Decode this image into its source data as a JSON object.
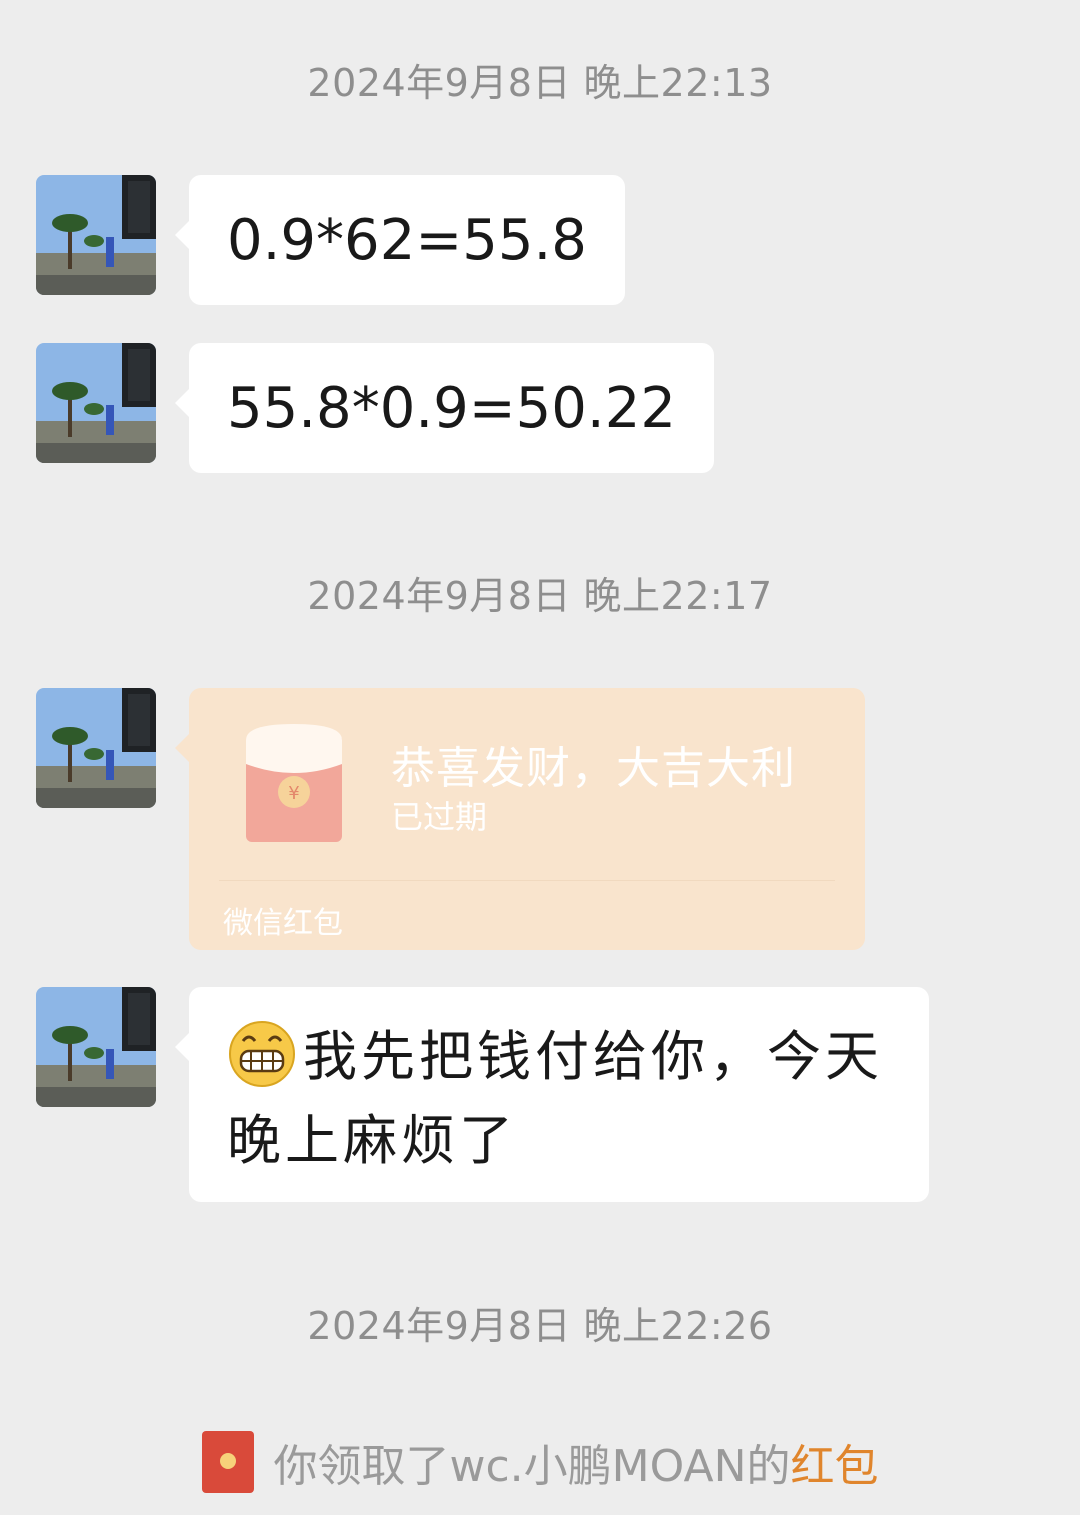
{
  "timestamps": [
    "2024年9月8日 晚上22:13",
    "2024年9月8日 晚上22:17",
    "2024年9月8日 晚上22:26"
  ],
  "messages": [
    {
      "type": "text",
      "text": "0.9*62=55.8"
    },
    {
      "type": "text",
      "text": "55.8*0.9=50.22"
    },
    {
      "type": "red_packet",
      "title": "恭喜发财，大吉大利",
      "status": "已过期",
      "brand": "微信红包"
    },
    {
      "type": "text",
      "line1": "我先把钱付给你，今天",
      "line2": "晚上麻烦了",
      "emoji": "grin-emoji"
    }
  ],
  "system_notice": {
    "prefix": "你领取了wc.小鹏MOAN的",
    "link": "红包",
    "icon": "red-packet-icon"
  },
  "colors": {
    "background": "#ededed",
    "bubble": "#ffffff",
    "red_packet_bg": "#f9e4cd",
    "link": "#e0852c"
  }
}
